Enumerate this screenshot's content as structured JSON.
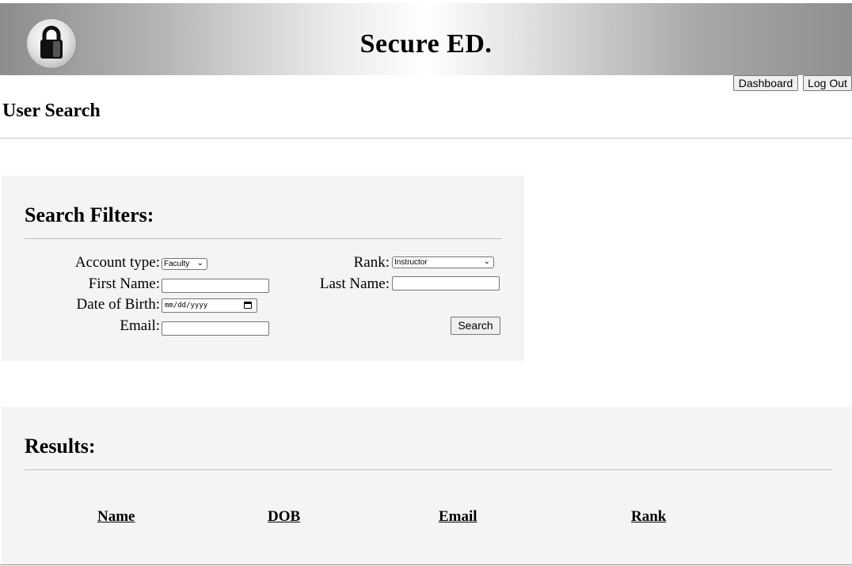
{
  "header": {
    "site_title": "Secure ED.",
    "logo_icon": "padlock-icon"
  },
  "nav": {
    "dashboard_label": "Dashboard",
    "logout_label": "Log Out"
  },
  "page": {
    "title": "User Search"
  },
  "filters": {
    "title": "Search Filters:",
    "account_type": {
      "label": "Account type:",
      "value": "Faculty"
    },
    "rank": {
      "label": "Rank:",
      "value": "Instructor"
    },
    "first_name": {
      "label": "First Name:",
      "value": ""
    },
    "last_name": {
      "label": "Last Name:",
      "value": ""
    },
    "dob": {
      "label": "Date of Birth:",
      "placeholder": "mm/dd/yyyy"
    },
    "email": {
      "label": "Email:",
      "value": ""
    },
    "search_label": "Search"
  },
  "results": {
    "title": "Results:",
    "columns": [
      "Name",
      "DOB",
      "Email",
      "Rank"
    ]
  },
  "colors": {
    "panel_bg": "#f4f4f4",
    "header_gradient_edge": "#8c8c8c",
    "header_gradient_center": "#ffffff"
  }
}
